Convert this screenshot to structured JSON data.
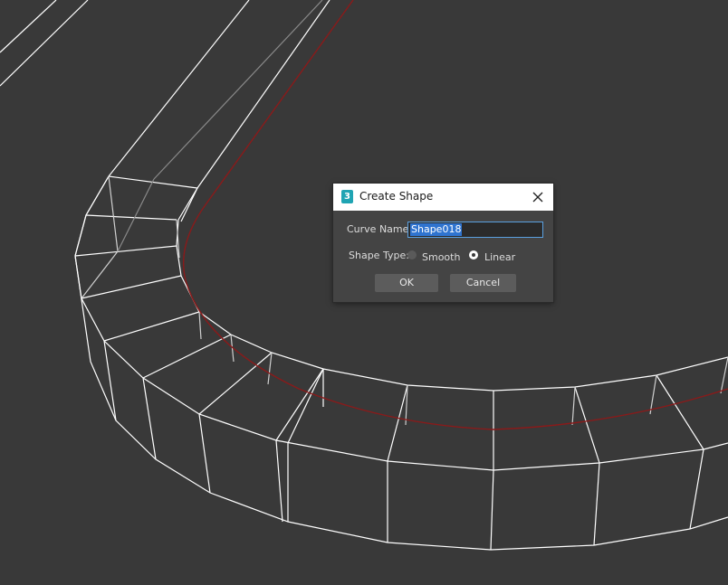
{
  "dialog": {
    "title": "Create Shape",
    "app_icon_glyph": "3",
    "curve_name_label": "Curve Name:",
    "curve_name_value": "Shape018",
    "shape_type_label": "Shape Type:",
    "options": {
      "smooth": "Smooth",
      "linear": "Linear"
    },
    "selected_shape_type": "Linear",
    "ok_label": "OK",
    "cancel_label": "Cancel"
  },
  "colors": {
    "viewport_bg": "#393939",
    "wire": "#ffffff",
    "spline": "#8a1a1a",
    "dialog_bg": "#444444",
    "selection": "#2f74d0"
  },
  "icons": {
    "app": "3ds-max-icon",
    "close": "close-icon"
  }
}
